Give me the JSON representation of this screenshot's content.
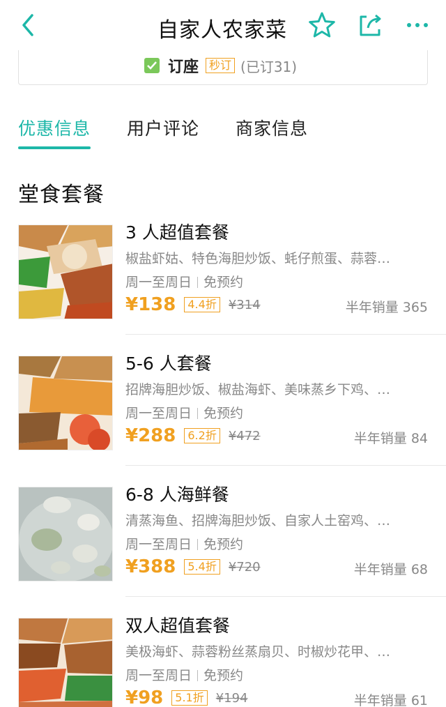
{
  "header": {
    "title": "自家人农家菜",
    "accent_color": "#1db7a8",
    "icons": [
      "back-icon",
      "star-icon",
      "share-icon",
      "more-icon"
    ]
  },
  "reserve": {
    "label": "订座",
    "badge": "秒订",
    "booked": "(已订31)"
  },
  "tabs": [
    {
      "label": "优惠信息",
      "active": true
    },
    {
      "label": "用户评论",
      "active": false
    },
    {
      "label": "商家信息",
      "active": false
    }
  ],
  "section_title": "堂食套餐",
  "deals": [
    {
      "name": "3 人超值套餐",
      "desc": "椒盐虾姑、特色海胆炒饭、蚝仔煎蛋、蒜蓉…",
      "days": "周一至周日",
      "reserve": "免预约",
      "price": "¥138",
      "discount": "4.4折",
      "original": "¥314",
      "sales": "半年销量 365"
    },
    {
      "name": "5-6 人套餐",
      "desc": "招牌海胆炒饭、椒盐海虾、美味蒸乡下鸡、…",
      "days": "周一至周日",
      "reserve": "免预约",
      "price": "¥288",
      "discount": "6.2折",
      "original": "¥472",
      "sales": "半年销量 84"
    },
    {
      "name": "6-8 人海鲜餐",
      "desc": "清蒸海鱼、招牌海胆炒饭、自家人土窑鸡、…",
      "days": "周一至周日",
      "reserve": "免预约",
      "price": "¥388",
      "discount": "5.4折",
      "original": "¥720",
      "sales": "半年销量 68"
    },
    {
      "name": "双人超值套餐",
      "desc": "美极海虾、蒜蓉粉丝蒸扇贝、时椒炒花甲、…",
      "days": "周一至周日",
      "reserve": "免预约",
      "price": "¥98",
      "discount": "5.1折",
      "original": "¥194",
      "sales": "半年销量 61"
    }
  ]
}
